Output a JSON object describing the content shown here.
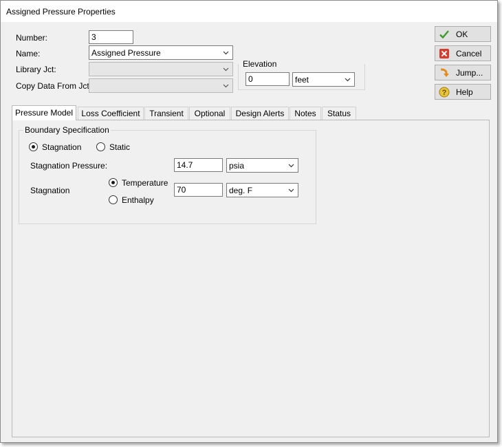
{
  "window": {
    "title": "Assigned Pressure Properties"
  },
  "form": {
    "number_label": "Number:",
    "number_value": "3",
    "name_label": "Name:",
    "name_value": "Assigned Pressure",
    "library_label": "Library Jct:",
    "library_value": "",
    "copy_label": "Copy Data From Jct...",
    "copy_value": ""
  },
  "elevation": {
    "group_label": "Elevation",
    "value": "0",
    "unit": "feet"
  },
  "buttons": {
    "ok": "OK",
    "cancel": "Cancel",
    "jump": "Jump...",
    "help": "Help"
  },
  "tabs": [
    {
      "label": "Pressure Model",
      "active": true
    },
    {
      "label": "Loss Coefficient",
      "active": false
    },
    {
      "label": "Transient",
      "active": false
    },
    {
      "label": "Optional",
      "active": false
    },
    {
      "label": "Design Alerts",
      "active": false
    },
    {
      "label": "Notes",
      "active": false
    },
    {
      "label": "Status",
      "active": false
    }
  ],
  "boundary": {
    "group_label": "Boundary Specification",
    "option_stagnation": "Stagnation",
    "option_static": "Static",
    "selected": "Stagnation",
    "pressure_label": "Stagnation Pressure:",
    "pressure_value": "14.7",
    "pressure_unit": "psia",
    "stagnation_label": "Stagnation",
    "option_temperature": "Temperature",
    "option_enthalpy": "Enthalpy",
    "thermo_selected": "Temperature",
    "temperature_value": "70",
    "temperature_unit": "deg. F"
  },
  "colors": {
    "check_green": "#3a9a2a",
    "cancel_red": "#d83a2e",
    "jump_orange": "#e28b1e",
    "help_yellow": "#e8c43a"
  },
  "icons": {
    "ok": "check-icon",
    "cancel": "x-icon",
    "jump": "jump-arrow-icon",
    "help": "help-icon",
    "dropdown": "chevron-down-icon"
  }
}
